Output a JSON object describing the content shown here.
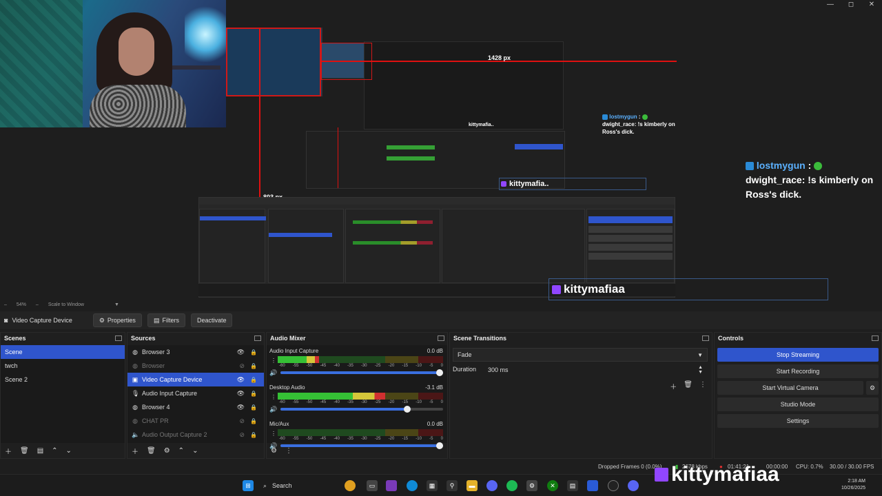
{
  "window": {
    "minimize": "—",
    "maximize": "◻",
    "close": "✕"
  },
  "preview": {
    "px_label_1": "1428 px",
    "px_label_2": "803 px",
    "chat_large": {
      "user": "lostmygun",
      "sep": ":",
      "msg_user": "dwight_race",
      "msg": ": !s kimberly on Ross's dick."
    },
    "chat_small": {
      "user": "lostmygun",
      "sep": ":",
      "msg_user": "dwight_race",
      "msg": ": !s kimberly on Ross's dick."
    },
    "kitty_large": "kittymafiaa",
    "kitty_mid": "kittymafia..",
    "kitty_small": "kittymafia.."
  },
  "zoom": {
    "level": "54%",
    "mode": "Scale to Window"
  },
  "source_toolbar": {
    "current": "Video Capture Device",
    "properties": "Properties",
    "filters": "Filters",
    "deactivate": "Deactivate"
  },
  "scenes": {
    "title": "Scenes",
    "items": [
      "Scene",
      "twch",
      "Scene 2"
    ],
    "selected": 0
  },
  "sources": {
    "title": "Sources",
    "items": [
      {
        "label": "Browser 3",
        "icon": "browser-icon",
        "visible": true,
        "dim": false
      },
      {
        "label": "Browser",
        "icon": "browser-icon",
        "visible": false,
        "dim": true
      },
      {
        "label": "Video Capture Device",
        "icon": "camera-icon",
        "visible": true,
        "dim": false,
        "selected": true
      },
      {
        "label": "Audio Input Capture",
        "icon": "microphone-icon",
        "visible": true,
        "dim": false
      },
      {
        "label": "Browser 4",
        "icon": "browser-icon",
        "visible": true,
        "dim": false
      },
      {
        "label": "CHAT PR",
        "icon": "browser-icon",
        "visible": false,
        "dim": true
      },
      {
        "label": "Audio Output Capture 2",
        "icon": "speaker-icon",
        "visible": false,
        "dim": true
      }
    ]
  },
  "mixer": {
    "title": "Audio Mixer",
    "ticks": [
      "-60",
      "-55",
      "-50",
      "-45",
      "-40",
      "-35",
      "-30",
      "-25",
      "-20",
      "-15",
      "-10",
      "-5",
      "0"
    ],
    "channels": [
      {
        "name": "Audio Input Capture",
        "db": "0.0 dB",
        "level": 0.25,
        "volume": 1.0
      },
      {
        "name": "Desktop Audio",
        "db": "-3.1 dB",
        "level": 0.65,
        "volume": 0.8
      },
      {
        "name": "Mic/Aux",
        "db": "0.0 dB",
        "level": 0.0,
        "volume": 1.0
      }
    ]
  },
  "transitions": {
    "title": "Scene Transitions",
    "selected": "Fade",
    "duration_label": "Duration",
    "duration_value": "300 ms"
  },
  "controls": {
    "title": "Controls",
    "stop_streaming": "Stop Streaming",
    "start_recording": "Start Recording",
    "start_virtual_camera": "Start Virtual Camera",
    "studio_mode": "Studio Mode",
    "settings": "Settings"
  },
  "status": {
    "dropped_frames": "Dropped Frames 0 (0.0%)",
    "bitrate": "2678 kbps",
    "stream_time": "01:41:21",
    "rec_time": "00:00:00",
    "cpu": "CPU: 0.7%",
    "fps": "30.00 / 30.00 FPS"
  },
  "overlay_name": "kittymafiaa",
  "taskbar": {
    "search": "Search",
    "time": "2:18 AM",
    "date": "10/26/2025"
  },
  "colors": {
    "accent": "#2f55cc",
    "twitch": "#9146ff",
    "meter_green": "#35c035",
    "guide_red": "#e01010"
  }
}
